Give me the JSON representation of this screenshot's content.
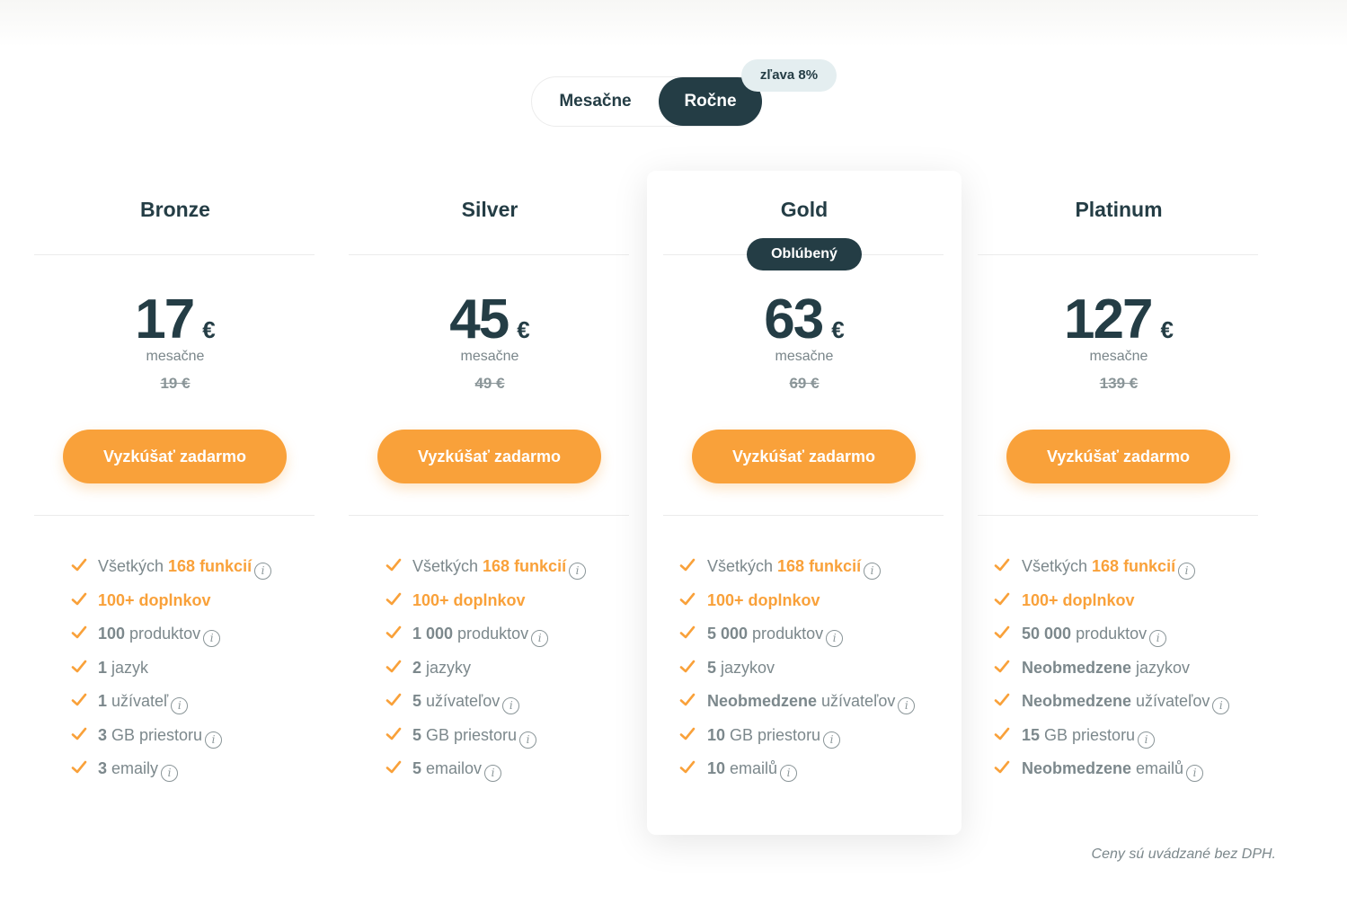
{
  "billing_toggle": {
    "monthly_label": "Mesačne",
    "yearly_label": "Ročne",
    "selected": "yearly",
    "discount_badge": "zľava 8%"
  },
  "colors": {
    "primary_dark": "#243d45",
    "accent_orange": "#f9a13a",
    "muted_text": "#7c888c"
  },
  "icons": {
    "feature_check": "check-icon",
    "info": "info-icon"
  },
  "plans": [
    {
      "name": "Bronze",
      "price": "17",
      "currency": "€",
      "period": "mesačne",
      "old_price": "19 €",
      "cta": "Vyzkúšať zadarmo",
      "features": [
        {
          "num": "",
          "pre": "Všetkých ",
          "orange": "168 funkcií",
          "text": "",
          "info": true
        },
        {
          "num": "",
          "pre": "",
          "orange": "100+ doplnkov",
          "text": "",
          "info": false
        },
        {
          "num": "100",
          "pre": "",
          "orange": "",
          "text": " produktov",
          "info": true
        },
        {
          "num": "1",
          "pre": "",
          "orange": "",
          "text": " jazyk",
          "info": false
        },
        {
          "num": "1",
          "pre": "",
          "orange": "",
          "text": " užívateľ",
          "info": true
        },
        {
          "num": "3",
          "pre": "",
          "orange": "",
          "text": " GB priestoru",
          "info": true
        },
        {
          "num": "3",
          "pre": "",
          "orange": "",
          "text": " emaily",
          "info": true
        }
      ]
    },
    {
      "name": "Silver",
      "price": "45",
      "currency": "€",
      "period": "mesačne",
      "old_price": "49 €",
      "cta": "Vyzkúšať zadarmo",
      "features": [
        {
          "num": "",
          "pre": "Všetkých ",
          "orange": "168 funkcií",
          "text": "",
          "info": true
        },
        {
          "num": "",
          "pre": "",
          "orange": "100+ doplnkov",
          "text": "",
          "info": false
        },
        {
          "num": "1 000",
          "pre": "",
          "orange": "",
          "text": " produktov",
          "info": true
        },
        {
          "num": "2",
          "pre": "",
          "orange": "",
          "text": " jazyky",
          "info": false
        },
        {
          "num": "5",
          "pre": "",
          "orange": "",
          "text": " užívateľov",
          "info": true
        },
        {
          "num": "5",
          "pre": "",
          "orange": "",
          "text": " GB priestoru",
          "info": true
        },
        {
          "num": "5",
          "pre": "",
          "orange": "",
          "text": " emailov",
          "info": true
        }
      ]
    },
    {
      "name": "Gold",
      "badge": "Oblúbený",
      "price": "63",
      "currency": "€",
      "period": "mesačne",
      "old_price": "69 €",
      "cta": "Vyzkúšať zadarmo",
      "features": [
        {
          "num": "",
          "pre": "Všetkých ",
          "orange": "168 funkcií",
          "text": "",
          "info": true
        },
        {
          "num": "",
          "pre": "",
          "orange": "100+ doplnkov",
          "text": "",
          "info": false
        },
        {
          "num": "5 000",
          "pre": "",
          "orange": "",
          "text": " produktov",
          "info": true
        },
        {
          "num": "5",
          "pre": "",
          "orange": "",
          "text": " jazykov",
          "info": false
        },
        {
          "num": "Neobmedzene",
          "pre": "",
          "orange": "",
          "text": " užívateľov",
          "info": true
        },
        {
          "num": "10",
          "pre": "",
          "orange": "",
          "text": " GB priestoru",
          "info": true
        },
        {
          "num": "10",
          "pre": "",
          "orange": "",
          "text": " emailů",
          "info": true
        }
      ]
    },
    {
      "name": "Platinum",
      "price": "127",
      "currency": "€",
      "period": "mesačne",
      "old_price": "139 €",
      "cta": "Vyzkúšať zadarmo",
      "features": [
        {
          "num": "",
          "pre": "Všetkých ",
          "orange": "168 funkcií",
          "text": "",
          "info": true
        },
        {
          "num": "",
          "pre": "",
          "orange": "100+ doplnkov",
          "text": "",
          "info": false
        },
        {
          "num": "50 000",
          "pre": "",
          "orange": "",
          "text": " produktov",
          "info": true
        },
        {
          "num": "Neobmedzene",
          "pre": "",
          "orange": "",
          "text": " jazykov",
          "info": false
        },
        {
          "num": "Neobmedzene",
          "pre": "",
          "orange": "",
          "text": " užívateľov",
          "info": true
        },
        {
          "num": "15",
          "pre": "",
          "orange": "",
          "text": " GB priestoru",
          "info": true
        },
        {
          "num": "Neobmedzene",
          "pre": "",
          "orange": "",
          "text": " emailů",
          "info": true
        }
      ]
    }
  ],
  "footnote": "Ceny sú uvádzané bez DPH."
}
